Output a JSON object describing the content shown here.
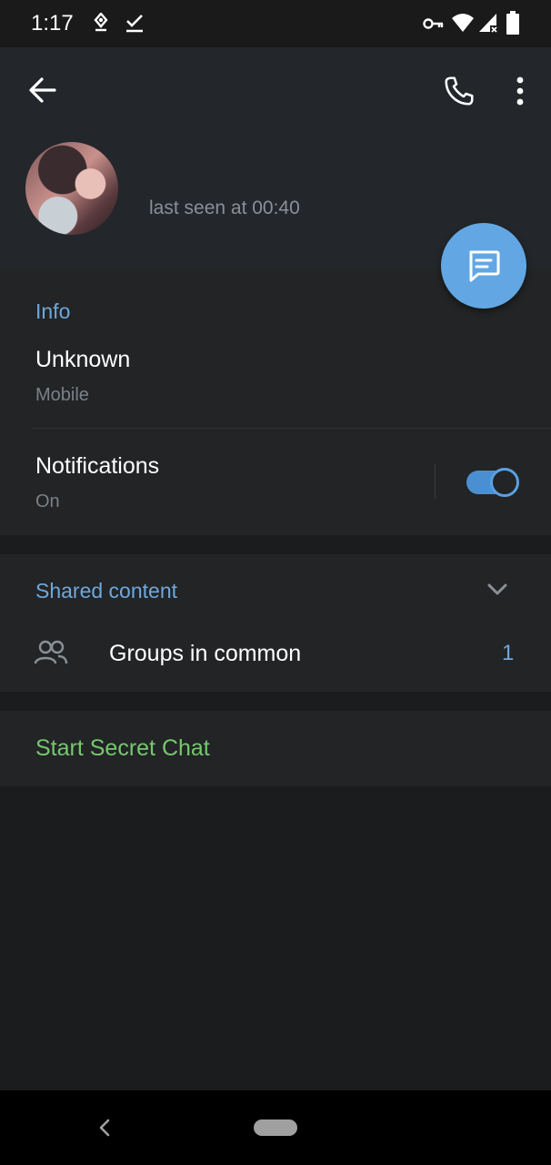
{
  "status_bar": {
    "time": "1:17"
  },
  "profile": {
    "status": "last seen at 00:40"
  },
  "info": {
    "title": "Info",
    "phone": "Unknown",
    "phone_label": "Mobile",
    "notifications": "Notifications",
    "notifications_value": "On",
    "notifications_enabled": true
  },
  "shared": {
    "title": "Shared content",
    "groups_label": "Groups in common",
    "groups_count": "1"
  },
  "secret_chat": {
    "label": "Start Secret Chat"
  },
  "colors": {
    "accent": "#6fa8dc",
    "fab": "#62a7e3",
    "secret_chat": "#76c76e",
    "toolbar": "#23272b",
    "section": "#222426",
    "background": "#1b1c1d"
  },
  "icons": [
    "back-arrow-icon",
    "phone-icon",
    "more-vert-icon",
    "message-icon",
    "chevron-down-icon",
    "groups-icon",
    "key-icon",
    "wifi-icon",
    "signal-icon",
    "battery-icon",
    "location-icon",
    "check-icon",
    "nav-back-icon"
  ]
}
